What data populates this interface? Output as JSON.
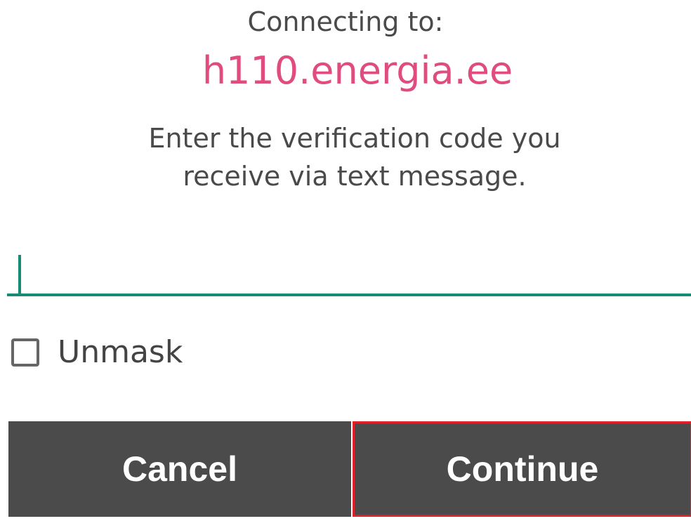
{
  "connection": {
    "connecting_label": "Connecting to:",
    "host": "h110.energia.ee"
  },
  "instructions": {
    "line1": "Enter the verification code you",
    "line2": "receive via text message."
  },
  "code_field": {
    "value": "",
    "placeholder": ""
  },
  "unmask": {
    "label": "Unmask",
    "checked": false
  },
  "actions": {
    "cancel_label": "Cancel",
    "continue_label": "Continue"
  },
  "colors": {
    "host_accent": "#e04b80",
    "input_accent": "#1a8a78",
    "button_bg": "#4b4b4b",
    "highlight_border": "#e0202a"
  }
}
